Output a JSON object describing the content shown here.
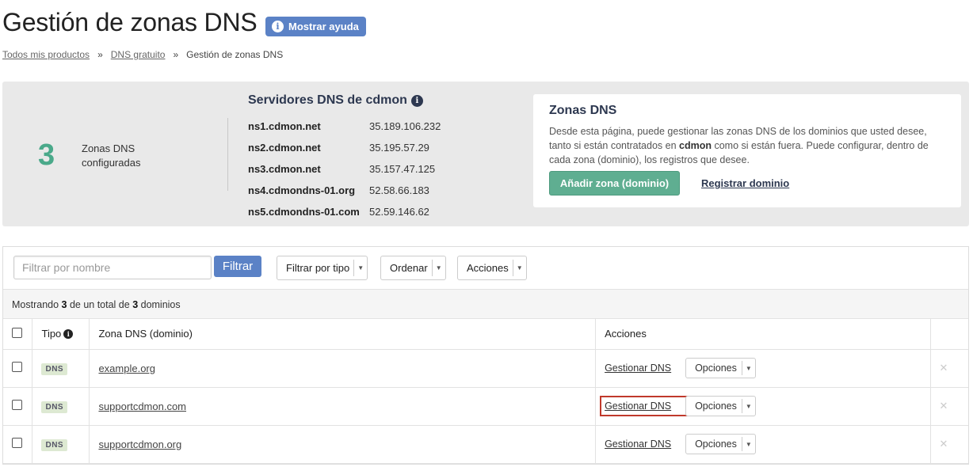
{
  "page": {
    "title": "Gestión de zonas DNS",
    "help_button": "Mostrar ayuda"
  },
  "breadcrumb": {
    "items": [
      "Todos mis productos",
      "DNS gratuito",
      "Gestión de zonas DNS"
    ],
    "separator": "»"
  },
  "summary_panel": {
    "zone_count": "3",
    "zone_count_label": "Zonas DNS configuradas",
    "dns_servers_title": "Servidores DNS de cdmon",
    "servers": [
      {
        "name": "ns1.cdmon.net",
        "ip": "35.189.106.232"
      },
      {
        "name": "ns2.cdmon.net",
        "ip": "35.195.57.29"
      },
      {
        "name": "ns3.cdmon.net",
        "ip": "35.157.47.125"
      },
      {
        "name": "ns4.cdmondns-01.org",
        "ip": "52.58.66.183"
      },
      {
        "name": "ns5.cdmondns-01.com",
        "ip": "52.59.146.62"
      }
    ]
  },
  "info_box": {
    "title": "Zonas DNS",
    "text_before": "Desde esta página, puede gestionar las zonas DNS de los dominios que usted desee, tanto si están contratados en ",
    "text_bold": "cdmon",
    "text_after": " como si están fuera. Puede configurar, dentro de cada zona (dominio), los registros que desee.",
    "add_zone_button": "Añadir zona (dominio)",
    "register_domain_link": "Registrar dominio"
  },
  "toolbar": {
    "filter_placeholder": "Filtrar por nombre",
    "filter_button": "Filtrar",
    "filter_type": "Filtrar por tipo",
    "order": "Ordenar",
    "actions": "Acciones"
  },
  "listing": {
    "prefix": "Mostrando ",
    "shown": "3",
    "middle": " de un total de ",
    "total": "3",
    "suffix": " dominios"
  },
  "table": {
    "headers": {
      "tipo": "Tipo",
      "zona": "Zona DNS (dominio)",
      "acciones": "Acciones"
    },
    "rows": [
      {
        "type": "DNS",
        "domain": "example.org",
        "manage": "Gestionar DNS",
        "options": "Opciones",
        "delete": "✕"
      },
      {
        "type": "DNS",
        "domain": "supportcdmon.com",
        "manage": "Gestionar DNS",
        "options": "Opciones",
        "delete": "✕"
      },
      {
        "type": "DNS",
        "domain": "supportcdmon.org",
        "manage": "Gestionar DNS",
        "options": "Opciones",
        "delete": "✕"
      }
    ]
  },
  "colors": {
    "primary_blue": "#5b82c6",
    "accent_green": "#5fae91",
    "count_green": "#4aa98a",
    "highlight_red": "#c0392b"
  }
}
